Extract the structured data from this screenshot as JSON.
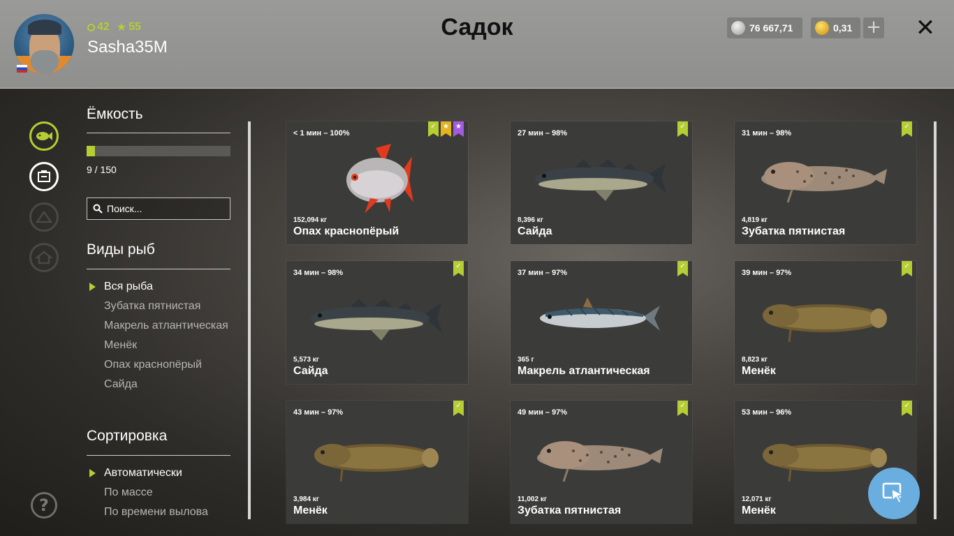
{
  "header": {
    "title": "Садок",
    "username": "Sasha35M",
    "level": "42",
    "rank": "55",
    "silver": "76 667,71",
    "gold": "0,31"
  },
  "sidebar": {
    "capacity_heading": "Ёмкость",
    "capacity_text": "9 / 150",
    "capacity_fraction": 0.06,
    "search_placeholder": "Поиск...",
    "species_heading": "Виды рыб",
    "species": [
      "Вся рыба",
      "Зубатка пятнистая",
      "Макрель атлантическая",
      "Менёк",
      "Опах краснопёрый",
      "Сайда"
    ],
    "sort_heading": "Сортировка",
    "sort": [
      "Автоматически",
      "По массе",
      "По времени вылова"
    ]
  },
  "cards": [
    {
      "time": "< 1 мин – 100%",
      "weight": "152,094 кг",
      "name": "Опах краснопёрый",
      "fish": "opah",
      "badges": [
        "check",
        "star",
        "star-purple"
      ]
    },
    {
      "time": "27 мин – 98%",
      "weight": "8,396 кг",
      "name": "Сайда",
      "fish": "pollock",
      "badges": [
        "check"
      ]
    },
    {
      "time": "31 мин – 98%",
      "weight": "4,819 кг",
      "name": "Зубатка пятнистая",
      "fish": "wolffish",
      "badges": [
        "check"
      ]
    },
    {
      "time": "34 мин – 98%",
      "weight": "5,573 кг",
      "name": "Сайда",
      "fish": "pollock",
      "badges": [
        "check"
      ]
    },
    {
      "time": "37 мин – 97%",
      "weight": "365 г",
      "name": "Макрель атлантическая",
      "fish": "mackerel",
      "badges": [
        "check"
      ]
    },
    {
      "time": "39 мин – 97%",
      "weight": "8,823 кг",
      "name": "Менёк",
      "fish": "tusk",
      "badges": [
        "check"
      ]
    },
    {
      "time": "43 мин – 97%",
      "weight": "3,984 кг",
      "name": "Менёк",
      "fish": "tusk",
      "badges": [
        "check"
      ]
    },
    {
      "time": "49 мин – 97%",
      "weight": "11,002 кг",
      "name": "Зубатка пятнистая",
      "fish": "wolffish",
      "badges": [
        "check"
      ]
    },
    {
      "time": "53 мин – 96%",
      "weight": "12,071 кг",
      "name": "Менёк",
      "fish": "tusk",
      "badges": [
        "check"
      ]
    }
  ],
  "colors": {
    "accent": "#b6cd34",
    "star_badge": "#e4b420",
    "purple_badge": "#a35ce0",
    "fab": "#6aaee0"
  }
}
